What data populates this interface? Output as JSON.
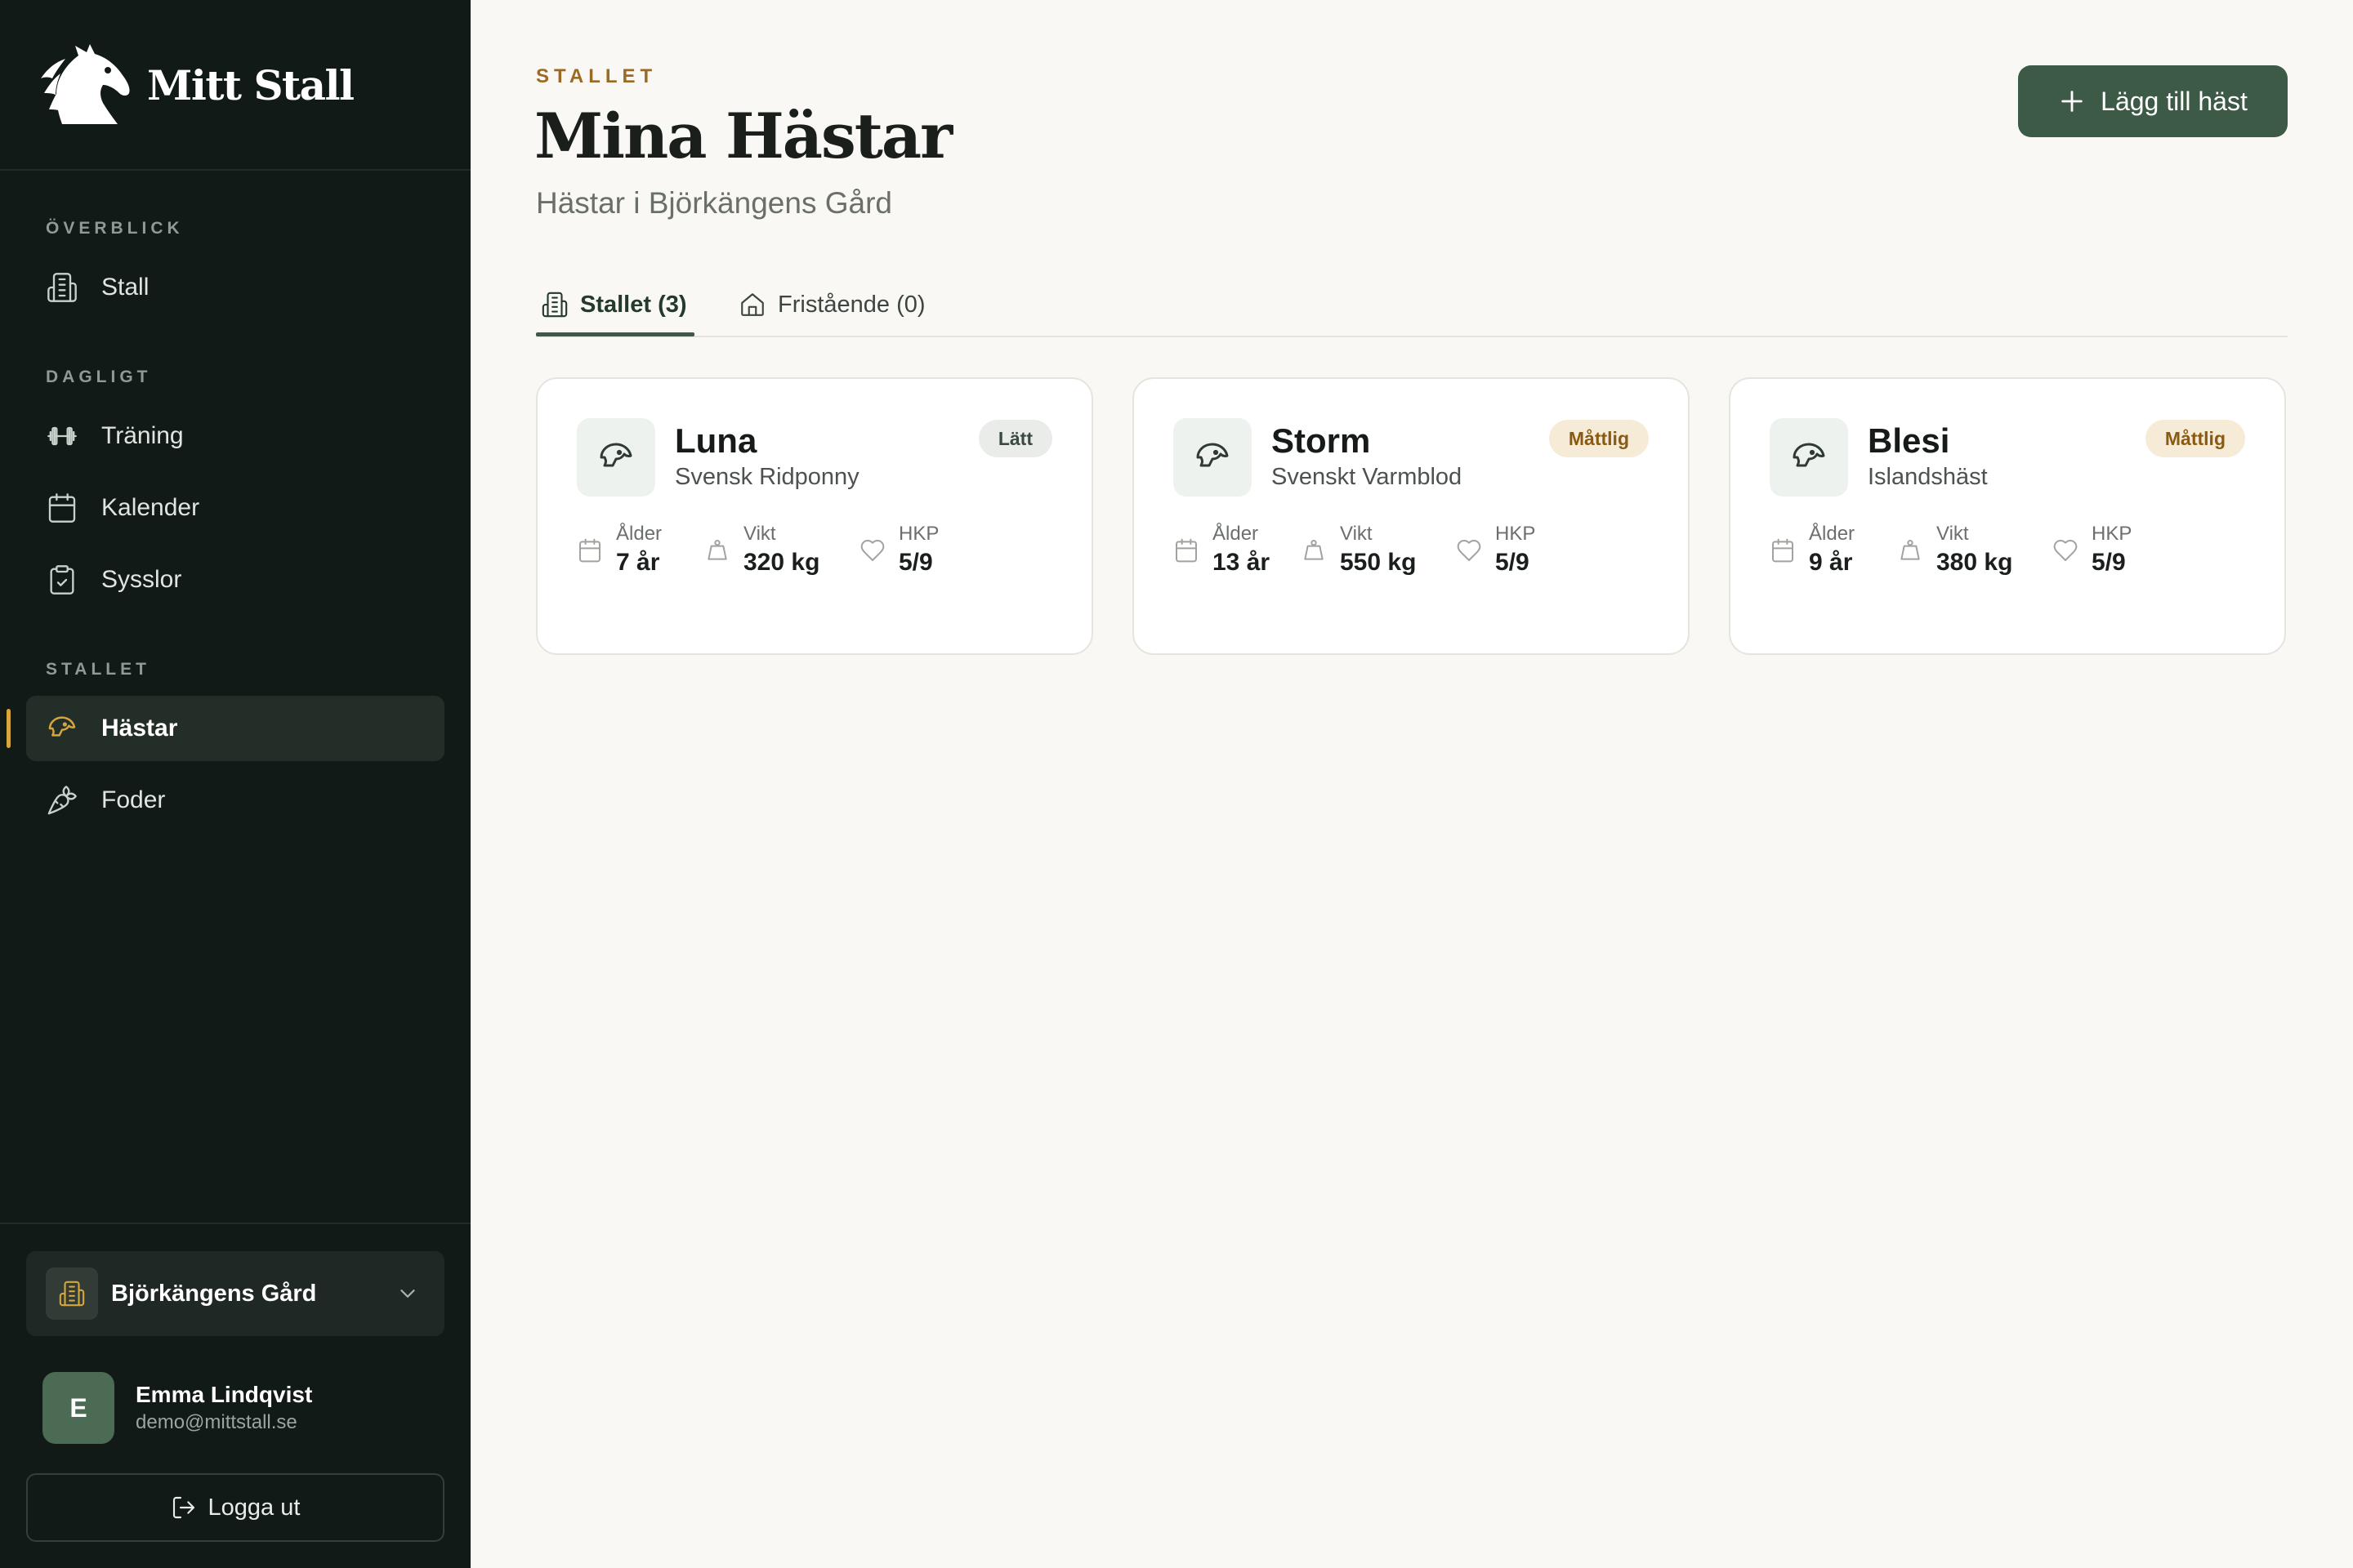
{
  "app": {
    "name": "Mitt Stall"
  },
  "sidebar": {
    "sections": [
      {
        "label": "ÖVERBLICK",
        "items": [
          {
            "label": "Stall",
            "icon": "building-icon"
          }
        ]
      },
      {
        "label": "DAGLIGT",
        "items": [
          {
            "label": "Träning",
            "icon": "dumbbell-icon"
          },
          {
            "label": "Kalender",
            "icon": "calendar-icon"
          },
          {
            "label": "Sysslor",
            "icon": "clipboard-check-icon"
          }
        ]
      },
      {
        "label": "STALLET",
        "items": [
          {
            "label": "Hästar",
            "icon": "horse-icon",
            "active": true
          },
          {
            "label": "Foder",
            "icon": "carrot-icon"
          }
        ]
      }
    ],
    "farm_selector": {
      "name": "Björkängens Gård"
    },
    "user": {
      "initial": "E",
      "name": "Emma Lindqvist",
      "email": "demo@mittstall.se"
    },
    "logout_label": "Logga ut"
  },
  "header": {
    "eyebrow": "STALLET",
    "title": "Mina Hästar",
    "subtitle": "Hästar i Björkängens Gård",
    "add_button_label": "Lägg till häst"
  },
  "tabs": [
    {
      "label": "Stallet (3)",
      "active": true
    },
    {
      "label": "Fristående (0)",
      "active": false
    }
  ],
  "horses": [
    {
      "name": "Luna",
      "breed": "Svensk Ridponny",
      "level": "Lätt",
      "level_kind": "easy",
      "stats": {
        "age_label": "Ålder",
        "age": "7 år",
        "weight_label": "Vikt",
        "weight": "320 kg",
        "hkp_label": "HKP",
        "hkp": "5/9"
      }
    },
    {
      "name": "Storm",
      "breed": "Svenskt Varmblod",
      "level": "Måttlig",
      "level_kind": "moderate",
      "stats": {
        "age_label": "Ålder",
        "age": "13 år",
        "weight_label": "Vikt",
        "weight": "550 kg",
        "hkp_label": "HKP",
        "hkp": "5/9"
      }
    },
    {
      "name": "Blesi",
      "breed": "Islandshäst",
      "level": "Måttlig",
      "level_kind": "moderate",
      "stats": {
        "age_label": "Ålder",
        "age": "9 år",
        "weight_label": "Vikt",
        "weight": "380 kg",
        "hkp_label": "HKP",
        "hkp": "5/9"
      }
    }
  ],
  "colors": {
    "sidebar_bg": "#111a16",
    "accent_green": "#3c5a45",
    "accent_gold": "#d4a63c",
    "page_bg": "#f9f8f4"
  }
}
